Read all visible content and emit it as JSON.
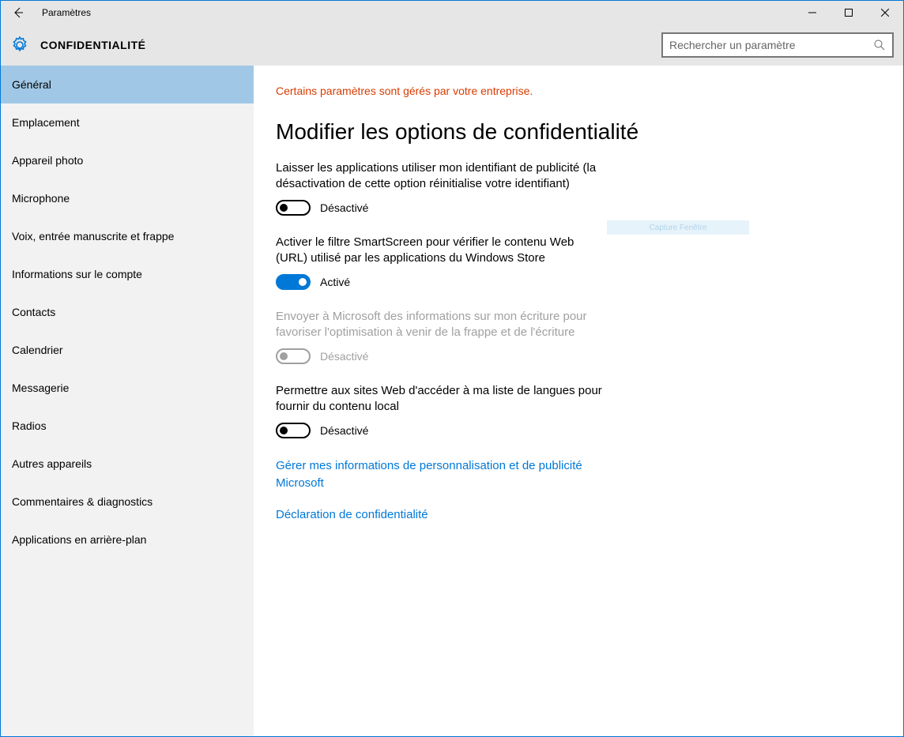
{
  "window": {
    "title": "Paramètres"
  },
  "header": {
    "title": "CONFIDENTIALITÉ",
    "search_placeholder": "Rechercher un paramètre"
  },
  "sidebar": {
    "items": [
      {
        "label": "Général",
        "active": true
      },
      {
        "label": "Emplacement",
        "active": false
      },
      {
        "label": "Appareil photo",
        "active": false
      },
      {
        "label": "Microphone",
        "active": false
      },
      {
        "label": "Voix, entrée manuscrite et frappe",
        "active": false
      },
      {
        "label": "Informations sur le compte",
        "active": false
      },
      {
        "label": "Contacts",
        "active": false
      },
      {
        "label": "Calendrier",
        "active": false
      },
      {
        "label": "Messagerie",
        "active": false
      },
      {
        "label": "Radios",
        "active": false
      },
      {
        "label": "Autres appareils",
        "active": false
      },
      {
        "label": "Commentaires & diagnostics",
        "active": false
      },
      {
        "label": "Applications en arrière-plan",
        "active": false
      }
    ]
  },
  "content": {
    "notice": "Certains paramètres sont gérés par votre entreprise.",
    "heading": "Modifier les options de confidentialité",
    "settings": [
      {
        "desc": "Laisser les applications utiliser mon identifiant de publicité (la désactivation de cette option réinitialise votre identifiant)",
        "state_label": "Désactivé",
        "on": false,
        "disabled": false
      },
      {
        "desc": "Activer le filtre SmartScreen pour vérifier le contenu Web (URL) utilisé par les applications du Windows Store",
        "state_label": "Activé",
        "on": true,
        "disabled": false
      },
      {
        "desc": "Envoyer à Microsoft des informations sur mon écriture pour favoriser l'optimisation à venir de la frappe et de l'écriture",
        "state_label": "Désactivé",
        "on": false,
        "disabled": true
      },
      {
        "desc": "Permettre aux sites Web d'accéder à ma liste de langues pour fournir du contenu local",
        "state_label": "Désactivé",
        "on": false,
        "disabled": false
      }
    ],
    "links": [
      "Gérer mes informations de personnalisation et de publicité Microsoft",
      "Déclaration de confidentialité"
    ],
    "ghost_tooltip": "Capture Fenêtre"
  }
}
